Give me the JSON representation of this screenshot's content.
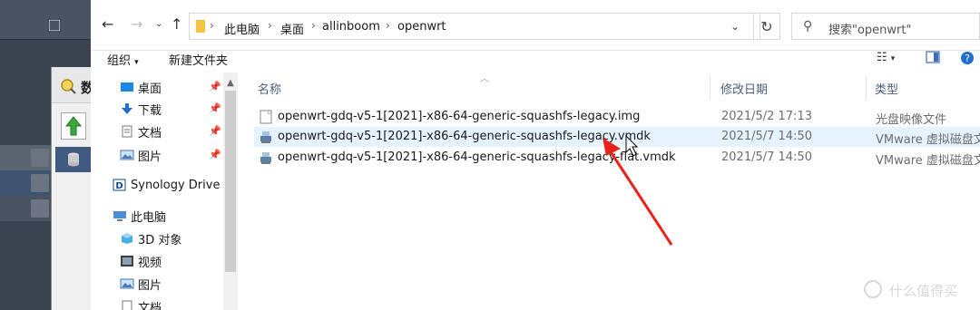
{
  "background_window": {},
  "peek_window": {
    "title_char": "数"
  },
  "address_bar": {
    "breadcrumbs": [
      "此电脑",
      "桌面",
      "allinboom",
      "openwrt"
    ],
    "search_placeholder": "搜索\"openwrt\""
  },
  "toolbar": {
    "organize_label": "组织",
    "new_folder_label": "新建文件夹"
  },
  "nav_pane": {
    "items": [
      {
        "label": "桌面",
        "icon": "desktop-icon",
        "pinned": true
      },
      {
        "label": "下载",
        "icon": "download-icon",
        "pinned": true
      },
      {
        "label": "文档",
        "icon": "document-icon",
        "pinned": true
      },
      {
        "label": "图片",
        "icon": "picture-icon",
        "pinned": true
      },
      {
        "label": "Synology Drive -",
        "icon": "synology-drive-icon",
        "pinned": false
      },
      {
        "label": "此电脑",
        "icon": "this-pc-icon",
        "pinned": false
      },
      {
        "label": "3D 对象",
        "icon": "3d-objects-icon",
        "pinned": false
      },
      {
        "label": "视频",
        "icon": "video-icon",
        "pinned": false
      },
      {
        "label": "图片",
        "icon": "picture-icon",
        "pinned": false
      },
      {
        "label": "文档",
        "icon": "document-icon",
        "pinned": false
      }
    ]
  },
  "file_list": {
    "columns": {
      "name": "名称",
      "modified": "修改日期",
      "type": "类型"
    },
    "rows": [
      {
        "name": "openwrt-gdq-v5-1[2021]-x86-64-generic-squashfs-legacy.img",
        "modified": "2021/5/2 17:13",
        "type": "光盘映像文件",
        "icon": "disc-image-file-icon"
      },
      {
        "name": "openwrt-gdq-v5-1[2021]-x86-64-generic-squashfs-legacy.vmdk",
        "modified": "2021/5/7 14:50",
        "type": "VMware 虚拟磁盘文",
        "icon": "vmdk-file-icon"
      },
      {
        "name": "openwrt-gdq-v5-1[2021]-x86-64-generic-squashfs-legacy-flat.vmdk",
        "modified": "2021/5/7 14:50",
        "type": "VMware 虚拟磁盘文",
        "icon": "vmdk-file-icon"
      }
    ]
  },
  "watermark": {
    "text": "什么值得买"
  },
  "colors": {
    "annotation_arrow": "#e8231b",
    "row_hover": "#e5f3ff",
    "column_header": "#4c607a"
  }
}
